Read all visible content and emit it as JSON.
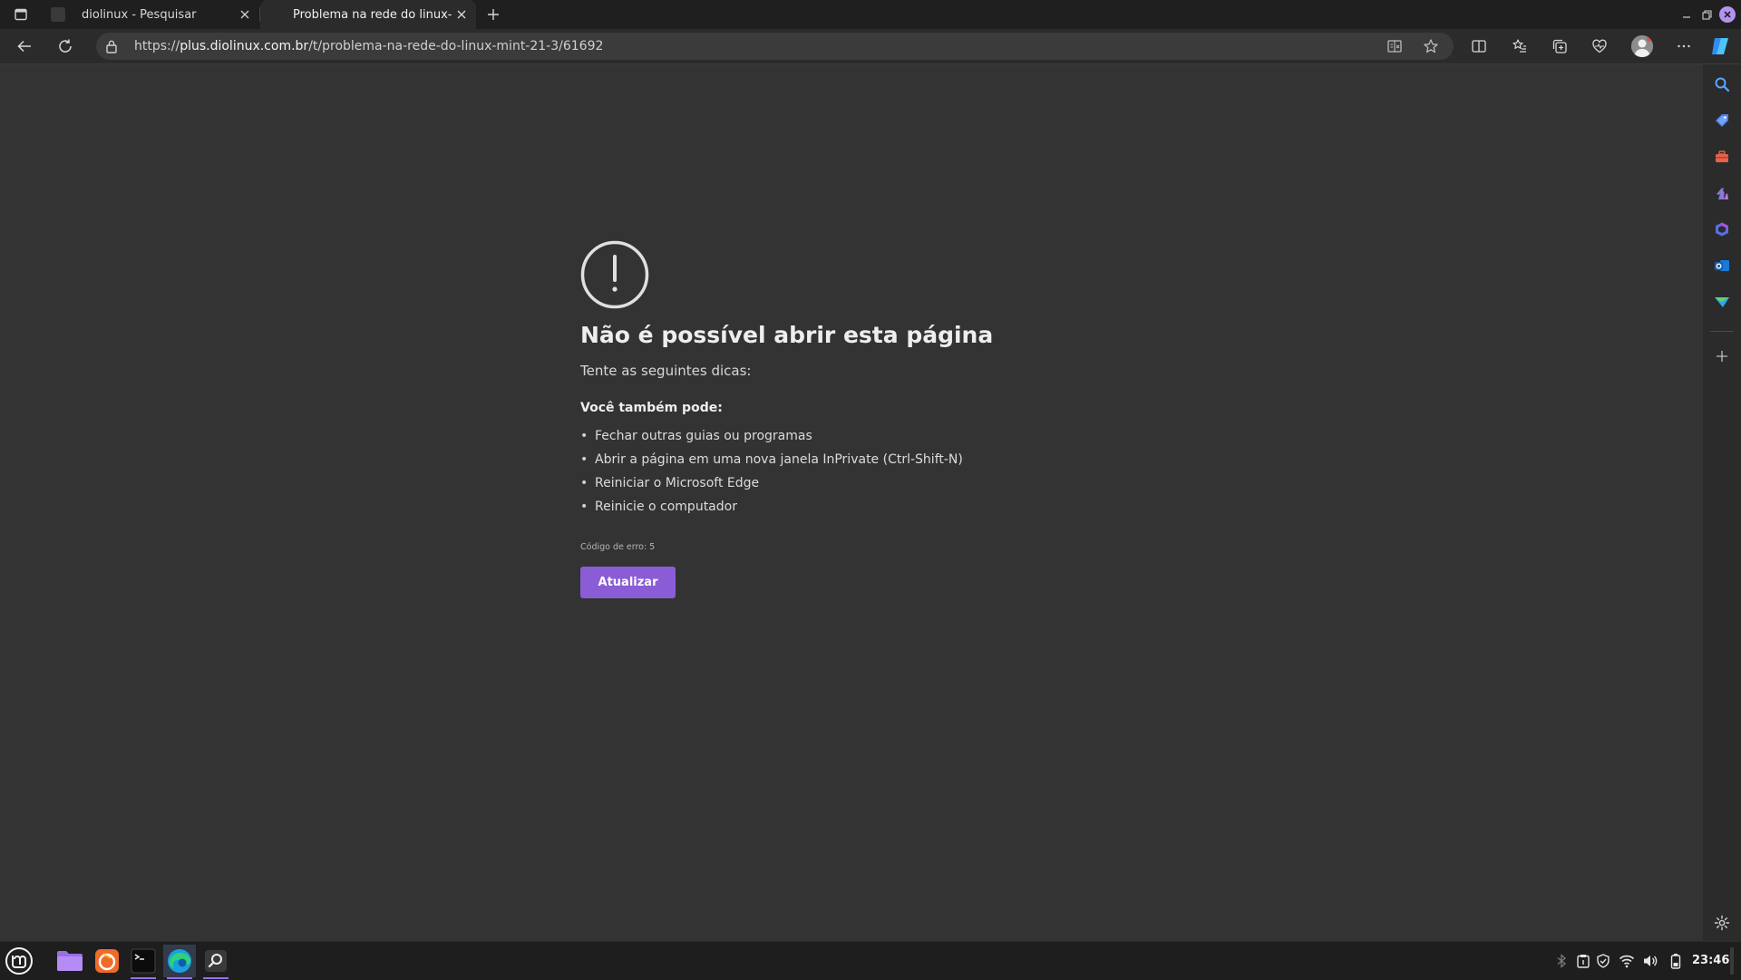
{
  "browser": {
    "tabs": [
      {
        "title": "diolinux - Pesquisar",
        "active": false
      },
      {
        "title": "Problema na rede do linux-mi",
        "active": true
      }
    ],
    "address": {
      "scheme": "https://",
      "host": "plus.diolinux.com.br",
      "path": "/t/problema-na-rede-do-linux-mint-21-3/61692"
    }
  },
  "error_page": {
    "title": "Não é possível abrir esta página",
    "subtitle": "Tente as seguintes dicas:",
    "also_heading": "Você também pode:",
    "tips": [
      "Fechar outras guias ou programas",
      "Abrir a página em uma nova janela InPrivate (Ctrl-Shift-N)",
      "Reiniciar o Microsoft Edge",
      "Reinicie o computador"
    ],
    "error_code": "Código de erro: 5",
    "refresh_label": "Atualizar"
  },
  "taskbar": {
    "clock": "23:46"
  },
  "colors": {
    "accent": "#8a5cd6",
    "page_bg": "#333333",
    "chrome_bg": "#2b2b2b",
    "tabstrip_bg": "#1f1f1f"
  }
}
